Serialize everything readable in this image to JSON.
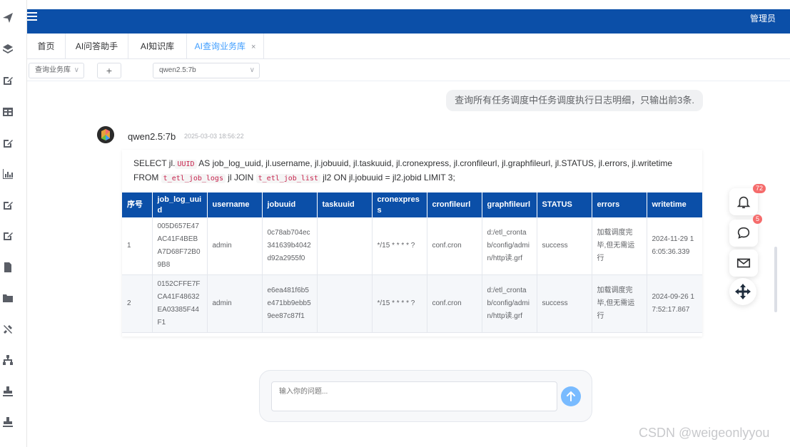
{
  "header": {
    "admin_label": "管理员"
  },
  "tabs": [
    {
      "label": "首页"
    },
    {
      "label": "AI问答助手"
    },
    {
      "label": "AI知识库"
    },
    {
      "label": "AI查询业务库",
      "close": "×"
    }
  ],
  "toolbar": {
    "query_select": "查询业务库",
    "add_label": "+",
    "model_select": "qwen2.5:7b"
  },
  "chat": {
    "user_message": "查询所有任务调度中任务调度执行日志明细，只输出前3条.",
    "model_name": "qwen2.5:7b",
    "timestamp": "2025-03-03 18:56:22",
    "sql": {
      "p1": "SELECT jl.",
      "c1": "UUID",
      "p2": " AS job_log_uuid, jl.username, jl.jobuuid, jl.taskuuid, jl.cronexpress, jl.cronfileurl, jl.graphfileurl, jl.STATUS, jl.errors, jl.writetime",
      "p3": "FROM ",
      "c2": "t_etl_job_logs",
      "p4": " jl JOIN ",
      "c3": "t_etl_job_list",
      "p5": " jl2 ON jl.jobuuid = jl2.jobid LIMIT 3;"
    },
    "table": {
      "headers": [
        "序号",
        "job_log_uuid",
        "username",
        "jobuuid",
        "taskuuid",
        "cronexpress",
        "cronfileurl",
        "graphfileurl",
        "STATUS",
        "errors",
        "writetime"
      ],
      "rows": [
        [
          "1",
          "005D657E47AC41F4BEBA7D68F72B09B8",
          "admin",
          "0c78ab704ec341639b4042d92a2955f0",
          "",
          "*/15 * * * * ?",
          "conf.cron",
          "d:/etl_crontab/config/admin/http读.grf",
          "success",
          "加载调度完毕,但无需运行",
          "2024-11-29 16:05:36.339"
        ],
        [
          "2",
          "0152CFFE7FCA41F48632EA03385F44F1",
          "admin",
          "e6ea481f6b5e471bb9ebb59ee87c87f1",
          "",
          "*/15 * * * * ?",
          "conf.cron",
          "d:/etl_crontab/config/admin/http读.grf",
          "success",
          "加载调度完毕,但无需运行",
          "2024-09-26 17:52:17.867"
        ]
      ]
    }
  },
  "float_panel": {
    "notifications": "72",
    "messages": "5"
  },
  "input": {
    "placeholder": "输入你的问题..."
  },
  "watermark": "CSDN @weigeonlyyou",
  "icons": [
    "paper-plane-icon",
    "layers-icon",
    "edit-icon",
    "table-icon",
    "edit-icon",
    "chart-icon",
    "edit-icon",
    "edit-icon",
    "file-icon",
    "folder-icon",
    "tools-icon",
    "network-icon",
    "stamp-icon",
    "stamp-icon"
  ]
}
